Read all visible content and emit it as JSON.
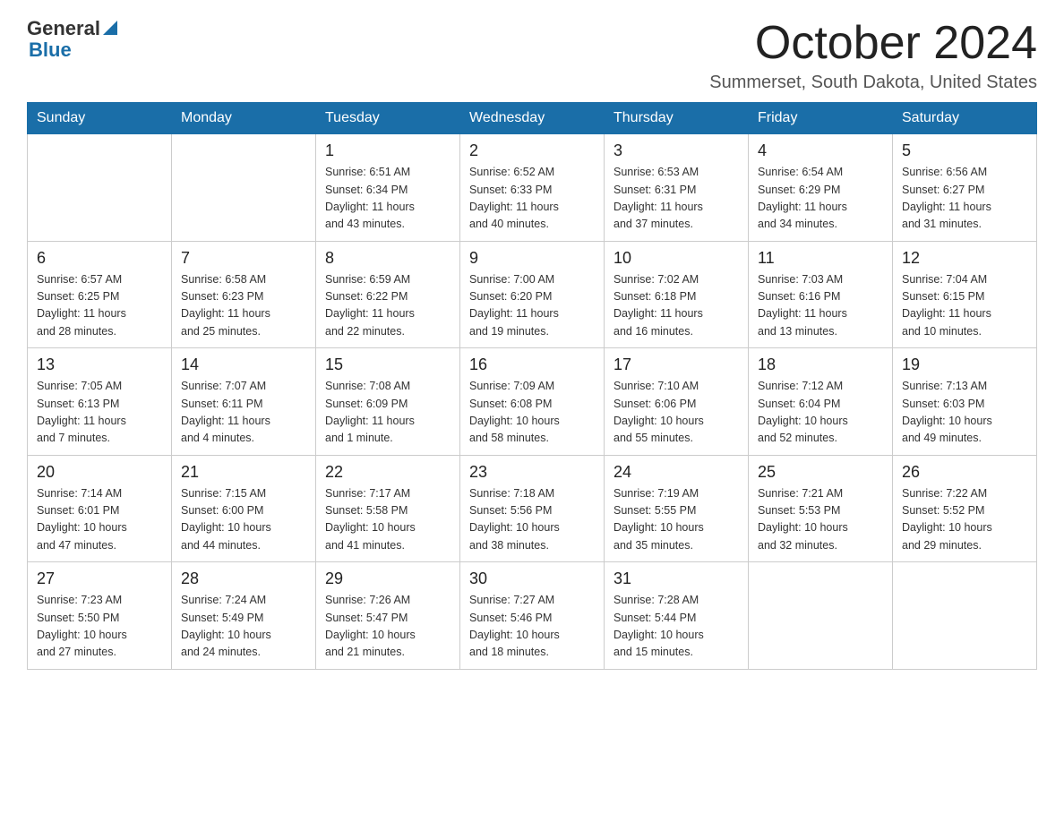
{
  "logo": {
    "general": "General",
    "blue": "Blue"
  },
  "title": "October 2024",
  "subtitle": "Summerset, South Dakota, United States",
  "days_of_week": [
    "Sunday",
    "Monday",
    "Tuesday",
    "Wednesday",
    "Thursday",
    "Friday",
    "Saturday"
  ],
  "weeks": [
    [
      {
        "day": "",
        "info": ""
      },
      {
        "day": "",
        "info": ""
      },
      {
        "day": "1",
        "info": "Sunrise: 6:51 AM\nSunset: 6:34 PM\nDaylight: 11 hours\nand 43 minutes."
      },
      {
        "day": "2",
        "info": "Sunrise: 6:52 AM\nSunset: 6:33 PM\nDaylight: 11 hours\nand 40 minutes."
      },
      {
        "day": "3",
        "info": "Sunrise: 6:53 AM\nSunset: 6:31 PM\nDaylight: 11 hours\nand 37 minutes."
      },
      {
        "day": "4",
        "info": "Sunrise: 6:54 AM\nSunset: 6:29 PM\nDaylight: 11 hours\nand 34 minutes."
      },
      {
        "day": "5",
        "info": "Sunrise: 6:56 AM\nSunset: 6:27 PM\nDaylight: 11 hours\nand 31 minutes."
      }
    ],
    [
      {
        "day": "6",
        "info": "Sunrise: 6:57 AM\nSunset: 6:25 PM\nDaylight: 11 hours\nand 28 minutes."
      },
      {
        "day": "7",
        "info": "Sunrise: 6:58 AM\nSunset: 6:23 PM\nDaylight: 11 hours\nand 25 minutes."
      },
      {
        "day": "8",
        "info": "Sunrise: 6:59 AM\nSunset: 6:22 PM\nDaylight: 11 hours\nand 22 minutes."
      },
      {
        "day": "9",
        "info": "Sunrise: 7:00 AM\nSunset: 6:20 PM\nDaylight: 11 hours\nand 19 minutes."
      },
      {
        "day": "10",
        "info": "Sunrise: 7:02 AM\nSunset: 6:18 PM\nDaylight: 11 hours\nand 16 minutes."
      },
      {
        "day": "11",
        "info": "Sunrise: 7:03 AM\nSunset: 6:16 PM\nDaylight: 11 hours\nand 13 minutes."
      },
      {
        "day": "12",
        "info": "Sunrise: 7:04 AM\nSunset: 6:15 PM\nDaylight: 11 hours\nand 10 minutes."
      }
    ],
    [
      {
        "day": "13",
        "info": "Sunrise: 7:05 AM\nSunset: 6:13 PM\nDaylight: 11 hours\nand 7 minutes."
      },
      {
        "day": "14",
        "info": "Sunrise: 7:07 AM\nSunset: 6:11 PM\nDaylight: 11 hours\nand 4 minutes."
      },
      {
        "day": "15",
        "info": "Sunrise: 7:08 AM\nSunset: 6:09 PM\nDaylight: 11 hours\nand 1 minute."
      },
      {
        "day": "16",
        "info": "Sunrise: 7:09 AM\nSunset: 6:08 PM\nDaylight: 10 hours\nand 58 minutes."
      },
      {
        "day": "17",
        "info": "Sunrise: 7:10 AM\nSunset: 6:06 PM\nDaylight: 10 hours\nand 55 minutes."
      },
      {
        "day": "18",
        "info": "Sunrise: 7:12 AM\nSunset: 6:04 PM\nDaylight: 10 hours\nand 52 minutes."
      },
      {
        "day": "19",
        "info": "Sunrise: 7:13 AM\nSunset: 6:03 PM\nDaylight: 10 hours\nand 49 minutes."
      }
    ],
    [
      {
        "day": "20",
        "info": "Sunrise: 7:14 AM\nSunset: 6:01 PM\nDaylight: 10 hours\nand 47 minutes."
      },
      {
        "day": "21",
        "info": "Sunrise: 7:15 AM\nSunset: 6:00 PM\nDaylight: 10 hours\nand 44 minutes."
      },
      {
        "day": "22",
        "info": "Sunrise: 7:17 AM\nSunset: 5:58 PM\nDaylight: 10 hours\nand 41 minutes."
      },
      {
        "day": "23",
        "info": "Sunrise: 7:18 AM\nSunset: 5:56 PM\nDaylight: 10 hours\nand 38 minutes."
      },
      {
        "day": "24",
        "info": "Sunrise: 7:19 AM\nSunset: 5:55 PM\nDaylight: 10 hours\nand 35 minutes."
      },
      {
        "day": "25",
        "info": "Sunrise: 7:21 AM\nSunset: 5:53 PM\nDaylight: 10 hours\nand 32 minutes."
      },
      {
        "day": "26",
        "info": "Sunrise: 7:22 AM\nSunset: 5:52 PM\nDaylight: 10 hours\nand 29 minutes."
      }
    ],
    [
      {
        "day": "27",
        "info": "Sunrise: 7:23 AM\nSunset: 5:50 PM\nDaylight: 10 hours\nand 27 minutes."
      },
      {
        "day": "28",
        "info": "Sunrise: 7:24 AM\nSunset: 5:49 PM\nDaylight: 10 hours\nand 24 minutes."
      },
      {
        "day": "29",
        "info": "Sunrise: 7:26 AM\nSunset: 5:47 PM\nDaylight: 10 hours\nand 21 minutes."
      },
      {
        "day": "30",
        "info": "Sunrise: 7:27 AM\nSunset: 5:46 PM\nDaylight: 10 hours\nand 18 minutes."
      },
      {
        "day": "31",
        "info": "Sunrise: 7:28 AM\nSunset: 5:44 PM\nDaylight: 10 hours\nand 15 minutes."
      },
      {
        "day": "",
        "info": ""
      },
      {
        "day": "",
        "info": ""
      }
    ]
  ]
}
